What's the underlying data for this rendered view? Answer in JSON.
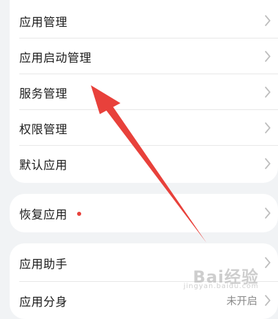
{
  "settings_group_1": {
    "items": [
      {
        "label": "应用管理"
      },
      {
        "label": "应用启动管理"
      },
      {
        "label": "服务管理"
      },
      {
        "label": "权限管理"
      },
      {
        "label": "默认应用"
      }
    ]
  },
  "settings_group_2": {
    "items": [
      {
        "label": "恢复应用",
        "badge": "red-dot"
      }
    ]
  },
  "settings_group_3": {
    "items": [
      {
        "label": "应用助手"
      },
      {
        "label": "应用分身",
        "value": "未开启"
      }
    ]
  },
  "annotation": {
    "type": "arrow",
    "color": "#e8413b",
    "points_to": "服务管理"
  },
  "watermark": {
    "text": "Bai经验",
    "sub": "jingyan.baidu.com"
  },
  "colors": {
    "background": "#f1f3f5",
    "card": "#ffffff",
    "text": "#1c1c1c",
    "chevron": "#bdbdbd",
    "badge_dot": "#e8413b"
  }
}
